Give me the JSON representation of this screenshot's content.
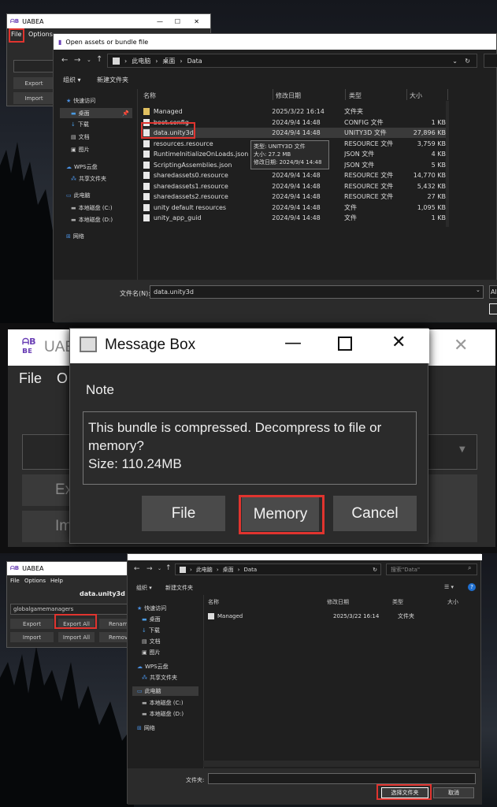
{
  "panel1": {
    "uabea_title": "UABEA",
    "menu": [
      "File",
      "Options"
    ],
    "side_buttons": [
      "Export",
      "Import"
    ],
    "dialog": {
      "title": "Open assets or bundle file",
      "breadcrumb": [
        "此电脑",
        "桌面",
        "Data"
      ],
      "toolbar": [
        "组织",
        "新建文件夹"
      ],
      "nav": [
        {
          "label": "快速访问",
          "level": 0
        },
        {
          "label": "桌面",
          "level": 1
        },
        {
          "label": "下载",
          "level": 1
        },
        {
          "label": "文档",
          "level": 1
        },
        {
          "label": "图片",
          "level": 1
        },
        {
          "label": "WPS云盘",
          "level": 0
        },
        {
          "label": "共享文件夹",
          "level": 1
        },
        {
          "label": "此电脑",
          "level": 0
        },
        {
          "label": "本地磁盘 (C:)",
          "level": 1
        },
        {
          "label": "本地磁盘 (D:)",
          "level": 1
        },
        {
          "label": "网络",
          "level": 0
        }
      ],
      "columns": [
        "名称",
        "修改日期",
        "类型",
        "大小"
      ],
      "files": [
        {
          "name": "Managed",
          "date": "2025/3/22 16:14",
          "type": "文件夹",
          "size": ""
        },
        {
          "name": "boot.config",
          "date": "2024/9/4 14:48",
          "type": "CONFIG 文件",
          "size": "1 KB"
        },
        {
          "name": "data.unity3d",
          "date": "2024/9/4 14:48",
          "type": "UNITY3D 文件",
          "size": "27,896 KB"
        },
        {
          "name": "resources.resource",
          "date": "",
          "type": "RESOURCE 文件",
          "size": "3,759 KB"
        },
        {
          "name": "RuntimeInitializeOnLoads.json",
          "date": "",
          "type": "JSON 文件",
          "size": "4 KB"
        },
        {
          "name": "ScriptingAssemblies.json",
          "date": "",
          "type": "JSON 文件",
          "size": "5 KB"
        },
        {
          "name": "sharedassets0.resource",
          "date": "2024/9/4 14:48",
          "type": "RESOURCE 文件",
          "size": "14,770 KB"
        },
        {
          "name": "sharedassets1.resource",
          "date": "2024/9/4 14:48",
          "type": "RESOURCE 文件",
          "size": "5,432 KB"
        },
        {
          "name": "sharedassets2.resource",
          "date": "2024/9/4 14:48",
          "type": "RESOURCE 文件",
          "size": "27 KB"
        },
        {
          "name": "unity default resources",
          "date": "2024/9/4 14:48",
          "type": "文件",
          "size": "1,095 KB"
        },
        {
          "name": "unity_app_guid",
          "date": "2024/9/4 14:48",
          "type": "文件",
          "size": "1 KB"
        }
      ],
      "tooltip": [
        "类型: UNITY3D 文件",
        "大小: 27.2 MB",
        "修改日期: 2024/9/4 14:48"
      ],
      "filename_label": "文件名(N):",
      "filename_value": "data.unity3d",
      "right_cut": "Al"
    }
  },
  "panel2": {
    "uabea_title": "UAE",
    "menu": [
      "File",
      "O"
    ],
    "behind_buttons": [
      "Ex",
      "Im"
    ],
    "title": "Message Box",
    "heading": "Note",
    "message": "This bundle is compressed. Decompress to file or memory?\nSize: 110.24MB",
    "buttons": [
      "File",
      "Memory",
      "Cancel"
    ]
  },
  "panel3": {
    "uabea_title": "UABEA",
    "menu": [
      "File",
      "Options",
      "Help"
    ],
    "bundle_name": "data.unity3d",
    "dropdown": "globalgamemanagers",
    "buttons": [
      "Export",
      "Export All",
      "Renam",
      "Import",
      "Import All",
      "Remove"
    ],
    "dialog": {
      "breadcrumb": [
        "此电脑",
        "桌面",
        "Data"
      ],
      "search_placeholder": "搜索\"Data\"",
      "toolbar": [
        "组织",
        "新建文件夹"
      ],
      "nav": [
        {
          "label": "快速访问",
          "level": 0
        },
        {
          "label": "桌面",
          "level": 1
        },
        {
          "label": "下载",
          "level": 1
        },
        {
          "label": "文档",
          "level": 1
        },
        {
          "label": "图片",
          "level": 1
        },
        {
          "label": "WPS云盘",
          "level": 0
        },
        {
          "label": "共享文件夹",
          "level": 1
        },
        {
          "label": "此电脑",
          "level": 0
        },
        {
          "label": "本地磁盘 (C:)",
          "level": 1
        },
        {
          "label": "本地磁盘 (D:)",
          "level": 1
        },
        {
          "label": "网络",
          "level": 0
        }
      ],
      "columns": [
        "名称",
        "修改日期",
        "类型",
        "大小"
      ],
      "files": [
        {
          "name": "Managed",
          "date": "2025/3/22 16:14",
          "type": "文件夹"
        }
      ],
      "folder_label": "文件夹:",
      "select_button": "选择文件夹",
      "cancel_button": "取消"
    }
  }
}
